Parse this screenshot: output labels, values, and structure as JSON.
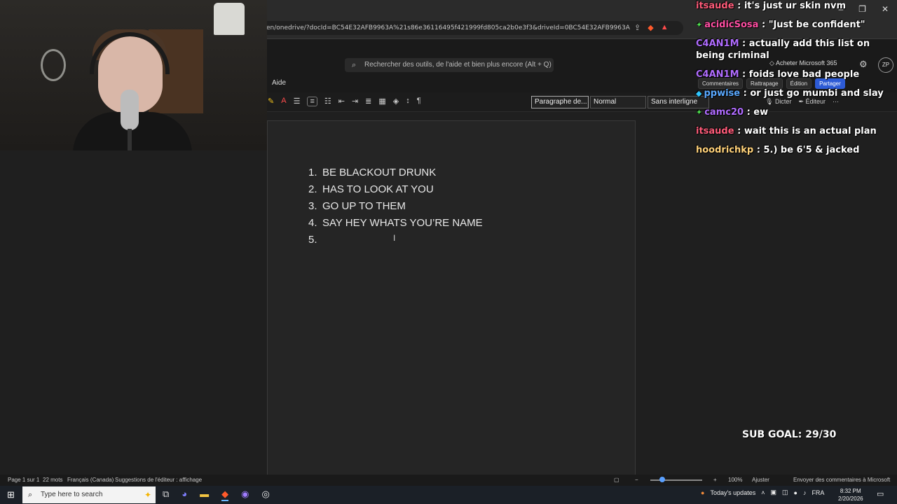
{
  "browser": {
    "url": "en/onedrive/?docId=BC54E32AFB9963A%21s86e36116495f421999fd805ca2b0e3f3&driveId=0BC54E32AFB9963A",
    "controls": {
      "minimize": "–",
      "restore": "❐",
      "close": "✕"
    }
  },
  "word": {
    "search_placeholder": "Rechercher des outils, de l'aide et bien plus encore (Alt + Q)",
    "buy_m365": "Acheter Microsoft 365",
    "avatar_initials": "ZP",
    "menu_aide": "Aide",
    "buttons": {
      "comments": "Commentaires",
      "catchup": "Rattrapage",
      "editing": "Édition",
      "share": "Partager"
    },
    "ribbon": {
      "style_paragraph": "Paragraphe de...",
      "style_normal": "Normal",
      "style_no_spacing": "Sans interligne",
      "dictate": "Dicter",
      "editor": "Éditeur"
    }
  },
  "document": {
    "list": [
      {
        "num": "1.",
        "text": "BE BLACKOUT DRUNK"
      },
      {
        "num": "2.",
        "text": "HAS TO LOOK AT YOU"
      },
      {
        "num": "3.",
        "text": "GO UP TO THEM"
      },
      {
        "num": "4.",
        "text": "SAY HEY WHATS YOU’RE NAME"
      },
      {
        "num": "5.",
        "text": ""
      }
    ]
  },
  "status_bar": {
    "page": "Page 1 sur 1",
    "words": "22 mots",
    "language": "Français (Canada)",
    "suggestions": "Suggestions de l'éditeur : affichage",
    "zoom": "100%",
    "fit": "Ajuster",
    "feedback": "Envoyer des commentaires à Microsoft"
  },
  "taskbar": {
    "search_placeholder": "Type here to search",
    "news": "Today's updates",
    "lang": "FRA",
    "time": "8:32 PM",
    "date": "2/20/2026"
  },
  "chat": {
    "messages": [
      {
        "user": "itsaude",
        "color": "#ff5c7a",
        "badge": "",
        "text": ": it's just ur skin nvm"
      },
      {
        "user": "acidicSosa",
        "color": "#ff4fa3",
        "badge": "green",
        "text": ": \"Just be confident\""
      },
      {
        "user": "C4AN1M",
        "color": "#b06cff",
        "badge": "",
        "text": ": actually add this list on being criminal"
      },
      {
        "user": "C4AN1M",
        "color": "#b06cff",
        "badge": "",
        "text": ": foids love bad people"
      },
      {
        "user": "ppwise",
        "color": "#5aa9ff",
        "badge": "cyan",
        "text": ": or just go mumbi and slay"
      },
      {
        "user": "camc20",
        "color": "#b06cff",
        "badge": "green",
        "text": ": ew"
      },
      {
        "user": "itsaude",
        "color": "#ff5c7a",
        "badge": "",
        "text": ": wait this is an actual plan"
      },
      {
        "user": "hoodrichkp",
        "color": "#ffd27a",
        "badge": "",
        "text": ": 5.) be 6'5 & jacked"
      }
    ],
    "sub_goal": "SUB GOAL: 29/30"
  }
}
